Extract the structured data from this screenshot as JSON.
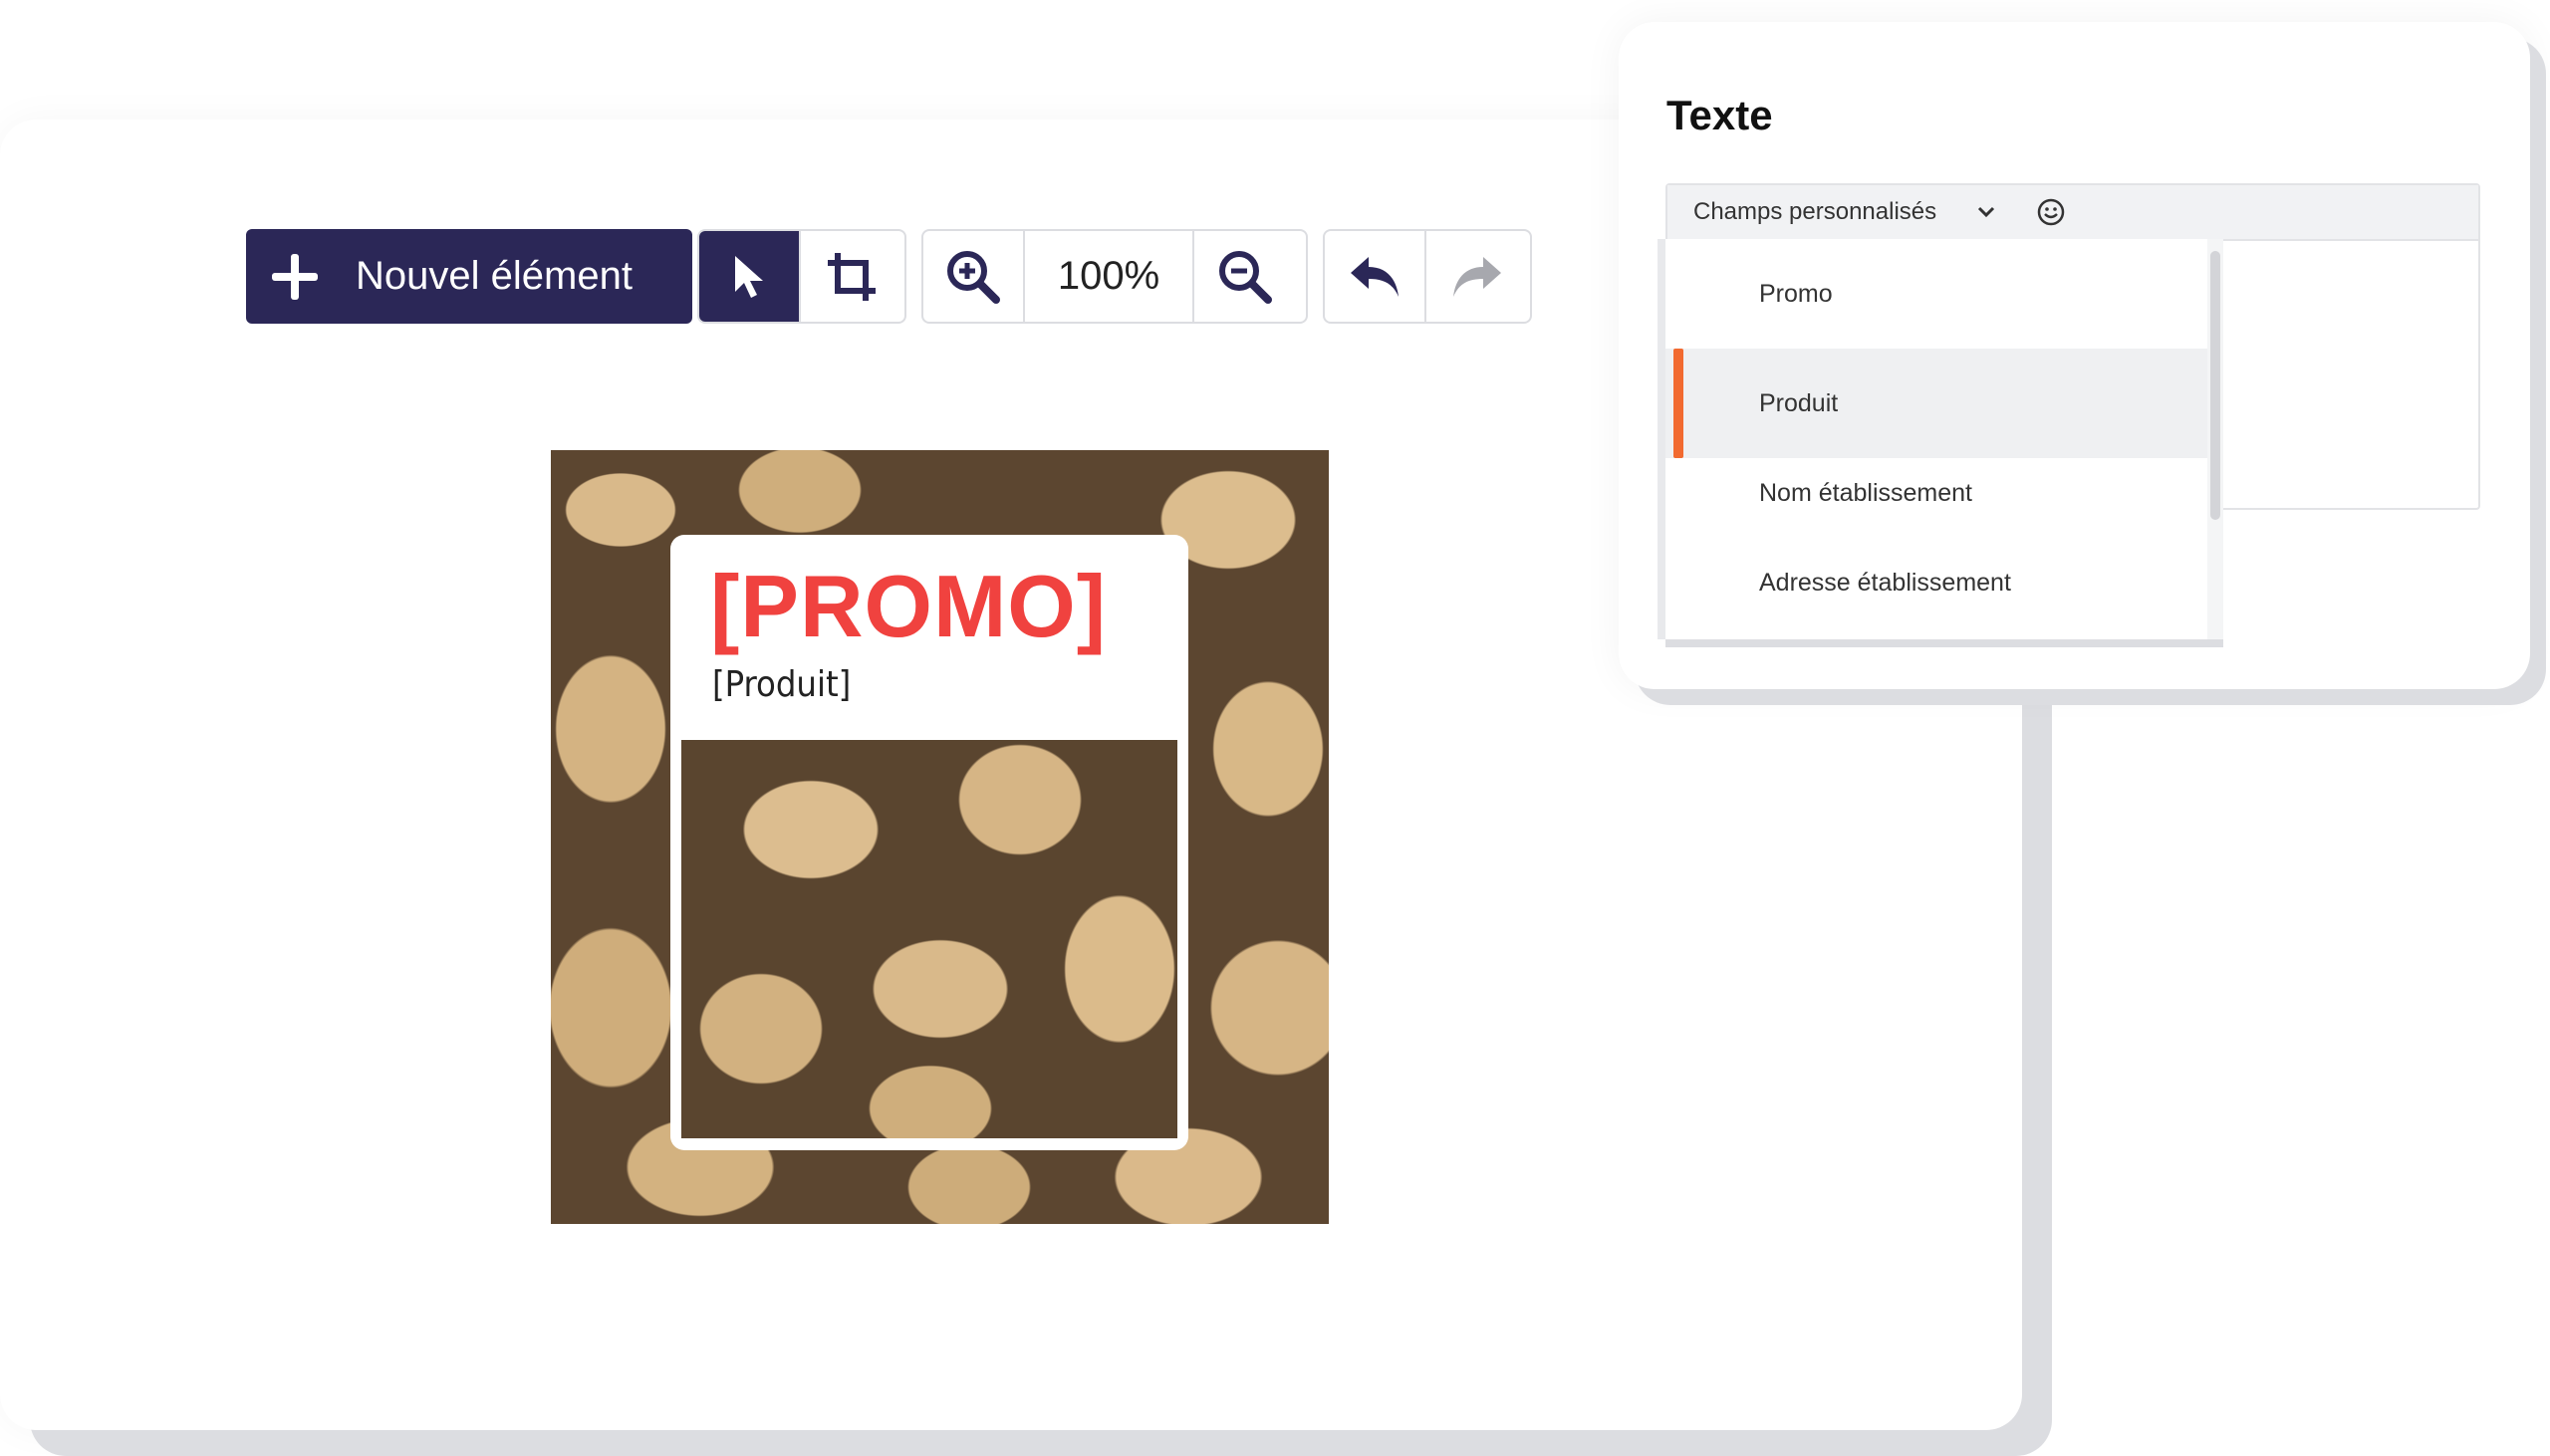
{
  "toolbar": {
    "new_element_label": "Nouvel élément",
    "zoom_value": "100%"
  },
  "poster": {
    "title": "[PROMO]",
    "subtitle": "[Produit]"
  },
  "text_panel": {
    "title": "Texte",
    "custom_fields_label": "Champs personnalisés",
    "dropdown_items": [
      {
        "label": "Promo",
        "selected": false
      },
      {
        "label": "Produit",
        "selected": true
      },
      {
        "label": "Nom établissement",
        "selected": false
      },
      {
        "label": "Adresse établissement",
        "selected": false
      }
    ]
  },
  "colors": {
    "primary": "#2b2757",
    "promo_red": "#f0423f",
    "selection_accent": "#f26a30"
  }
}
